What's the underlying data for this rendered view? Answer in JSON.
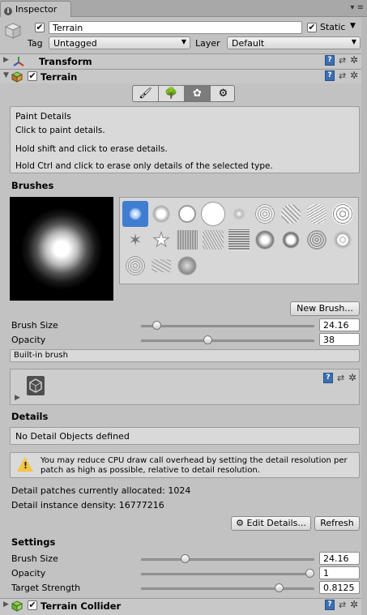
{
  "window": {
    "tab_label": "Inspector",
    "tab_icon": "i",
    "menu_icon": "▾ ≡"
  },
  "object": {
    "name": "Terrain",
    "static_label": "Static",
    "static_checked": "✔",
    "active_checked": "✔",
    "tag_label": "Tag",
    "tag_value": "Untagged",
    "layer_label": "Layer",
    "layer_value": "Default"
  },
  "components": {
    "transform": {
      "title": "Transform",
      "tri": "▶"
    },
    "terrain": {
      "title": "Terrain",
      "tri": "▼",
      "checked": "✔"
    },
    "collider": {
      "title": "Terrain Collider",
      "tri": "▶",
      "checked": "✔"
    }
  },
  "icons": {
    "help": "?",
    "presets": "⇄",
    "gear": "✲",
    "brush": "🖌",
    "tree": "🌳",
    "details": "✿",
    "settings": "⚙"
  },
  "toolbar": {
    "tools": [
      "raise-lower-tool",
      "paint-trees-tool",
      "paint-details-tool",
      "settings-tool"
    ],
    "selected": "paint-details-tool"
  },
  "help": {
    "title": "Paint Details",
    "line1": "Click to paint details.",
    "line2": "Hold shift and click to erase details.",
    "line3": "Hold Ctrl and click to erase only details of the selected type."
  },
  "brushes": {
    "heading": "Brushes",
    "new_button": "New Brush...",
    "size_label": "Brush Size",
    "size_value": "24.16",
    "size_fraction": 0.07,
    "opacity_label": "Opacity",
    "opacity_value": "38",
    "opacity_fraction": 0.38,
    "builtin_label": "Built-in brush"
  },
  "details": {
    "heading": "Details",
    "empty_text": "No Detail Objects defined",
    "warning": "You may reduce CPU draw call overhead by setting the detail resolution per patch as high as possible, relative to detail resolution.",
    "patches": "Detail patches currently allocated: 1024",
    "density": "Detail instance density: 16777216",
    "edit_button": "Edit Details...",
    "refresh_button": "Refresh"
  },
  "settings": {
    "heading": "Settings",
    "brush_size_label": "Brush Size",
    "brush_size_value": "24.16",
    "brush_size_fraction": 0.24,
    "opacity_label": "Opacity",
    "opacity_value": "1",
    "opacity_fraction": 1.0,
    "strength_label": "Target Strength",
    "strength_value": "0.8125",
    "strength_fraction": 0.8125
  }
}
